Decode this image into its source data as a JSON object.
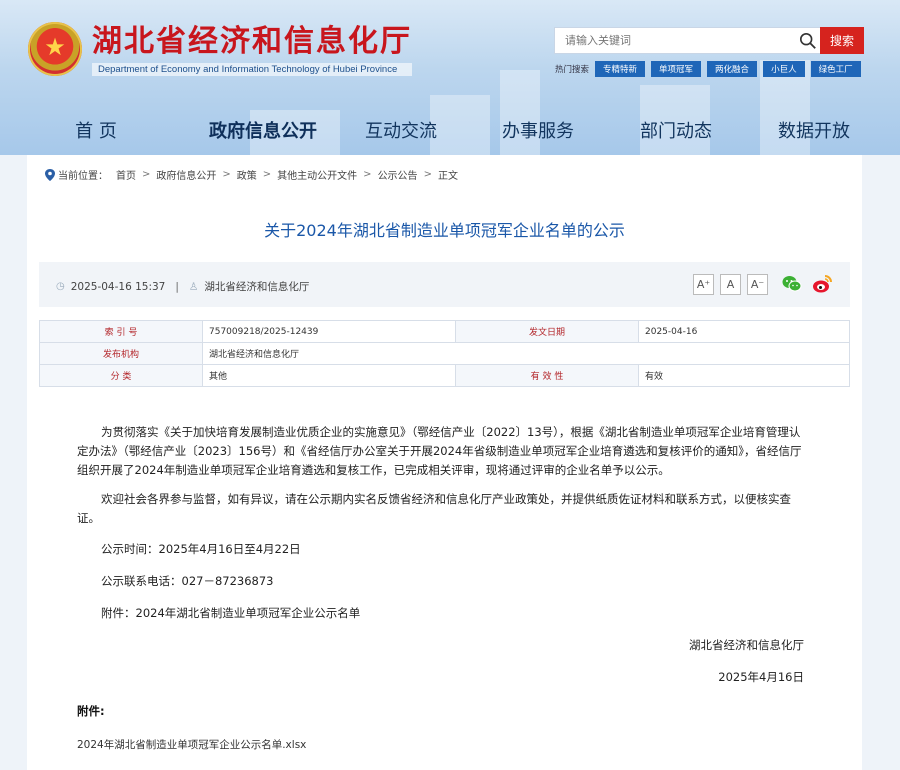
{
  "header": {
    "site_title": "湖北省经济和信息化厅",
    "site_subtitle": "Department of Economy and Information Technology of Hubei Province",
    "search_placeholder": "请输入关键词",
    "search_button": "搜索",
    "hot_label": "热门搜索",
    "hot_tags": [
      "专精特新",
      "单项冠军",
      "两化融合",
      "小巨人",
      "绿色工厂"
    ],
    "emblem_glyph": "★"
  },
  "nav": {
    "items": [
      {
        "label": "首 页",
        "active": false
      },
      {
        "label": "政府信息公开",
        "active": true
      },
      {
        "label": "互动交流",
        "active": false
      },
      {
        "label": "办事服务",
        "active": false
      },
      {
        "label": "部门动态",
        "active": false
      },
      {
        "label": "数据开放",
        "active": false
      }
    ]
  },
  "breadcrumb": {
    "prefix": "当前位置：",
    "items": [
      "首页",
      "政府信息公开",
      "政策",
      "其他主动公开文件",
      "公示公告",
      "正文"
    ],
    "separator": ">"
  },
  "article": {
    "title": "关于2024年湖北省制造业单项冠军企业名单的公示",
    "date": "2025-04-16 15:37",
    "divider": "|",
    "publisher": "湖北省经济和信息化厅",
    "font_buttons": [
      "A⁺",
      "A",
      "A⁻"
    ]
  },
  "info_table": {
    "index_label": "索 引 号",
    "index_value": "757009218/2025-12439",
    "date_label": "发文日期",
    "date_value": "2025-04-16",
    "org_label": "发布机构",
    "org_value": "湖北省经济和信息化厅",
    "category_label": "分 类",
    "category_value": "其他",
    "validity_label": "有 效 性",
    "validity_value": "有效"
  },
  "body": {
    "para1": "为贯彻落实《关于加快培育发展制造业优质企业的实施意见》（鄂经信产业〔2022〕13号），根据《湖北省制造业单项冠军企业培育管理认定办法》（鄂经信产业〔2023〕156号）和《省经信厅办公室关于开展2024年省级制造业单项冠军企业培育遴选和复核评价的通知》，省经信厅组织开展了2024年制造业单项冠军企业培育遴选和复核工作，已完成相关评审，现将通过评审的企业名单予以公示。",
    "para2": "欢迎社会各界参与监督，如有异议，请在公示期内实名反馈省经济和信息化厅产业政策处，并提供纸质佐证材料和联系方式，以便核实查证。",
    "period": "公示时间：2025年4月16日至4月22日",
    "phone": "公示联系电话：027－87236873",
    "attachment_line": "附件：2024年湖北省制造业单项冠军企业公示名单",
    "sign_org": "湖北省经济和信息化厅",
    "sign_date": "2025年4月16日"
  },
  "attachments": {
    "label": "附件:",
    "file": "2024年湖北省制造业单项冠军企业公示名单.xlsx"
  },
  "colors": {
    "brand_red": "#c8161d",
    "link_blue": "#1a57a8",
    "nav_blue": "#12355e",
    "tag_blue": "#1f66b8"
  }
}
